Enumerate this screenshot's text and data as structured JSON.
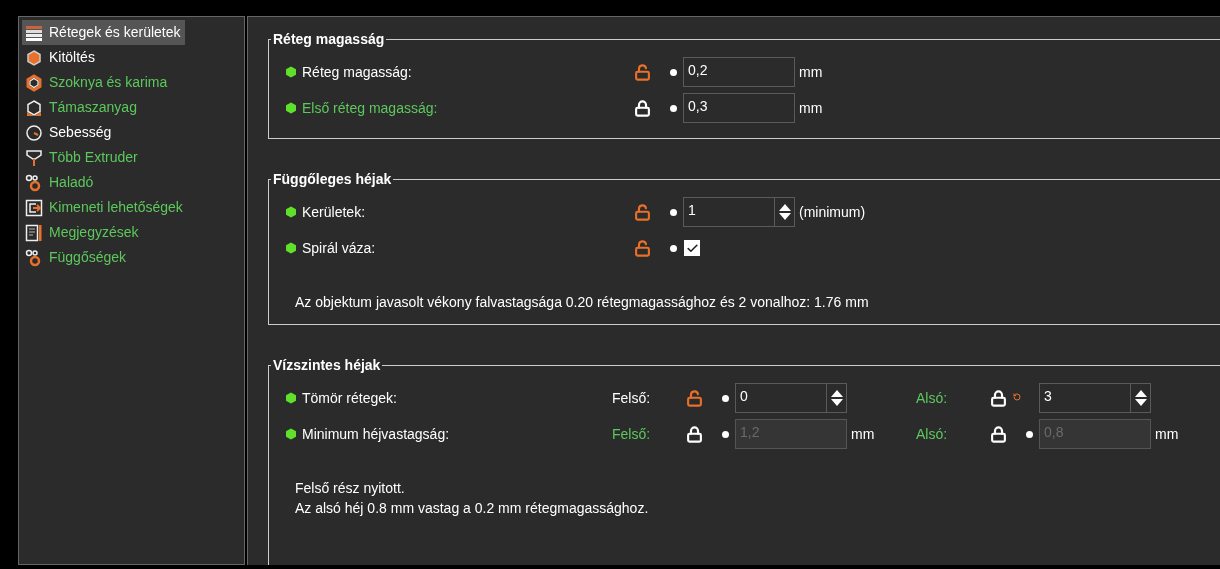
{
  "sidebar": {
    "items": [
      {
        "label": "Rétegek és kerületek",
        "selected": true,
        "modified": false,
        "kind": "layers"
      },
      {
        "label": "Kitöltés",
        "selected": false,
        "modified": false,
        "kind": "infill"
      },
      {
        "label": "Szoknya és karima",
        "selected": false,
        "modified": true,
        "kind": "skirt"
      },
      {
        "label": "Támaszanyag",
        "selected": false,
        "modified": true,
        "kind": "support"
      },
      {
        "label": "Sebesség",
        "selected": false,
        "modified": false,
        "kind": "speed"
      },
      {
        "label": "Több Extruder",
        "selected": false,
        "modified": true,
        "kind": "extruder"
      },
      {
        "label": "Haladó",
        "selected": false,
        "modified": true,
        "kind": "gears"
      },
      {
        "label": "Kimeneti lehetőségek",
        "selected": false,
        "modified": true,
        "kind": "output"
      },
      {
        "label": "Megjegyzések",
        "selected": false,
        "modified": true,
        "kind": "notes"
      },
      {
        "label": "Függőségek",
        "selected": false,
        "modified": true,
        "kind": "gears"
      }
    ]
  },
  "sections": [
    {
      "title": "Réteg magasság",
      "rows": [
        {
          "label": "Réteg magasság:",
          "modified": false,
          "fields": [
            {
              "locked": false,
              "reset": false,
              "kind": "text",
              "value": "0,2",
              "unit": "mm",
              "disabled": false
            }
          ]
        },
        {
          "label": "Első réteg magasság:",
          "modified": true,
          "fields": [
            {
              "locked": true,
              "reset": false,
              "kind": "text",
              "value": "0,3",
              "unit": "mm",
              "disabled": false
            }
          ]
        }
      ]
    },
    {
      "title": "Függőleges héjak",
      "rows": [
        {
          "label": "Kerületek:",
          "modified": false,
          "fields": [
            {
              "locked": false,
              "reset": false,
              "kind": "spin",
              "value": "1",
              "unit": "(minimum)"
            }
          ]
        },
        {
          "label": "Spirál váza:",
          "modified": false,
          "fields": [
            {
              "locked": false,
              "reset": false,
              "kind": "checkbox",
              "checked": true
            }
          ]
        }
      ],
      "note": [
        "Az objektum javasolt vékony falvastagsága 0.20 rétegmagassághoz és 2 vonalhoz: 1.76 mm"
      ]
    },
    {
      "title": "Vízszintes héjak",
      "rows": [
        {
          "label": "Tömör rétegek:",
          "modified": false,
          "fields": [
            {
              "sublabel": "Felső:",
              "sublabel_modified": false,
              "locked": false,
              "reset": false,
              "kind": "spin",
              "value": "0"
            },
            {
              "sublabel": "Alsó:",
              "sublabel_modified": true,
              "locked": true,
              "reset": true,
              "kind": "spin",
              "value": "3"
            }
          ]
        },
        {
          "label": "Minimum héjvastagság:",
          "modified": false,
          "fields": [
            {
              "sublabel": "Felső:",
              "sublabel_modified": true,
              "locked": true,
              "reset": false,
              "kind": "text",
              "value": "1,2",
              "unit": "mm",
              "disabled": true
            },
            {
              "sublabel": "Alsó:",
              "sublabel_modified": true,
              "locked": true,
              "reset": false,
              "kind": "text",
              "value": "0,8",
              "unit": "mm",
              "disabled": true
            }
          ]
        }
      ],
      "note": [
        "Felső rész nyitott.",
        "Az alsó héj 0.8 mm vastag a 0.2 mm rétegmagassághoz."
      ]
    }
  ]
}
